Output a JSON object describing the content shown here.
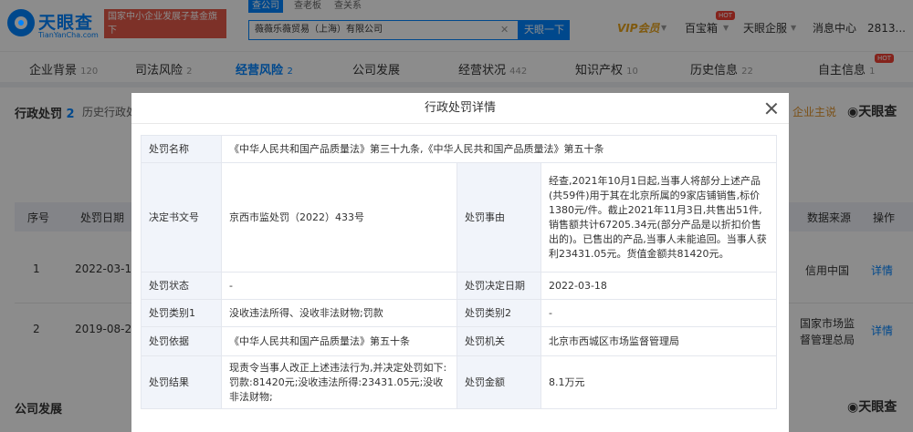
{
  "header": {
    "logo_text": "天眼查",
    "logo_sub": "TianYanCha.com",
    "slogan_line1": "国家中小企业发展子基金旗下",
    "slogan_line2": "官方备案企业征信机构",
    "search_tabs": [
      "查公司",
      "查老板",
      "查关系"
    ],
    "search_value": "薇薇乐薇贸易（上海）有限公司",
    "search_button": "天眼一下",
    "vip_label": "VIP会员",
    "baibaoxiang": "百宝箱",
    "hot_badge": "HOT",
    "enterprise": "天眼企服",
    "messages": "消息中心",
    "user": "2813..."
  },
  "tabbar": {
    "items": [
      {
        "label": "企业背景",
        "count": "120"
      },
      {
        "label": "司法风险",
        "count": "2"
      },
      {
        "label": "经营风险",
        "count": "2"
      },
      {
        "label": "公司发展",
        "count": ""
      },
      {
        "label": "经营状况",
        "count": "442"
      },
      {
        "label": "知识产权",
        "count": "10"
      },
      {
        "label": "历史信息",
        "count": "22"
      },
      {
        "label": "自主信息",
        "count": "1"
      }
    ],
    "hot_badge": "HOT"
  },
  "background": {
    "section_title": "行政处罚",
    "section_count": "2",
    "history_tab": "历史行政处",
    "right_link": "企业主说",
    "right_logo": "天眼查",
    "columns": [
      "序号",
      "处罚日期",
      "数据来源",
      "操作"
    ],
    "rows": [
      {
        "index": "1",
        "date": "2022-03-18",
        "source": "信用中国",
        "action": "详情"
      },
      {
        "index": "2",
        "date": "2019-08-27",
        "source_line1": "国家市场监",
        "source_line2": "督管理总局",
        "action": "详情"
      }
    ],
    "section2_title": "公司发展",
    "section2_logo": "天眼查"
  },
  "modal": {
    "title": "行政处罚详情",
    "rows": {
      "name_label": "处罚名称",
      "name_value": "《中华人民共和国产品质量法》第三十九条,《中华人民共和国产品质量法》第五十条",
      "doc_label": "决定书文号",
      "doc_value": "京西市监处罚（2022）433号",
      "reason_label": "处罚事由",
      "reason_value": "经查,2021年10月1日起,当事人将部分上述产品(共59件)用于其在北京所属的9家店铺销售,标价1380元/件。截止2021年11月3日,共售出51件,销售额共计67205.34元(部分产品是以折扣价售出的)。已售出的产品,当事人未能追回。当事人获利23431.05元。货值金额共81420元。",
      "status_label": "处罚状态",
      "status_value": "-",
      "decide_date_label": "处罚决定日期",
      "decide_date_value": "2022-03-18",
      "type1_label": "处罚类别1",
      "type1_value": "没收违法所得、没收非法财物;罚款",
      "type2_label": "处罚类别2",
      "type2_value": "-",
      "basis_label": "处罚依据",
      "basis_value": "《中华人民共和国产品质量法》第五十条",
      "org_label": "处罚机关",
      "org_value": "北京市西城区市场监督管理局",
      "result_label": "处罚结果",
      "result_value": "现责令当事人改正上述违法行为,并决定处罚如下:罚款:81420元;没收违法所得:23431.05元;没收非法财物;",
      "amount_label": "处罚金额",
      "amount_value": "8.1万元"
    }
  }
}
